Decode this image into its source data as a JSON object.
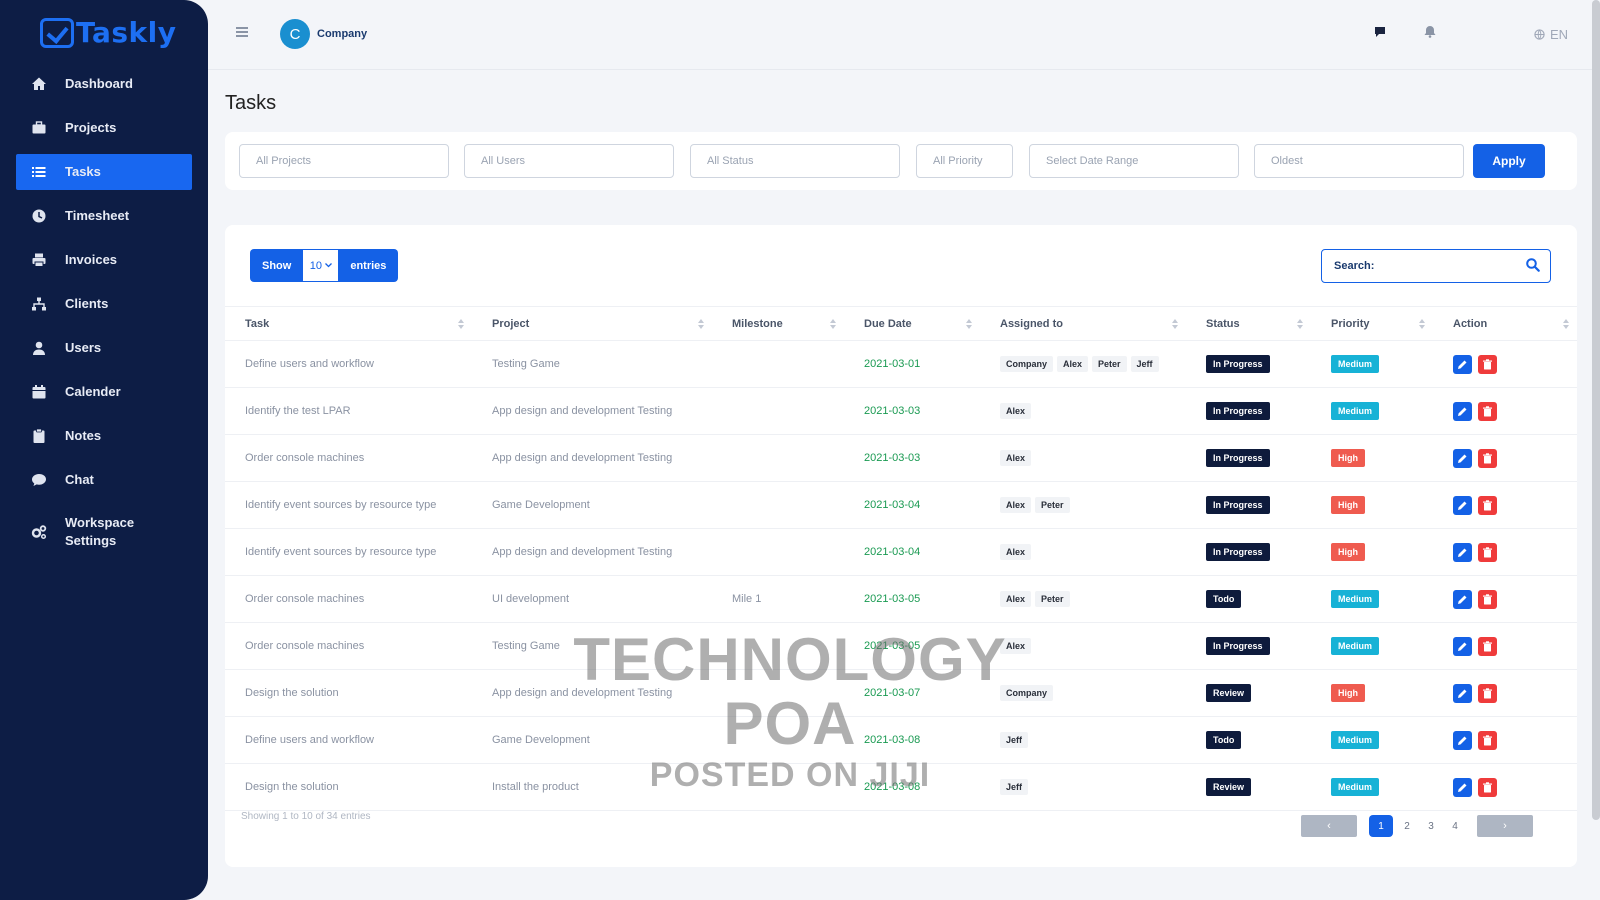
{
  "app": {
    "name": "Taskly"
  },
  "sidebar": {
    "items": [
      {
        "label": "Dashboard",
        "icon": "home-icon"
      },
      {
        "label": "Projects",
        "icon": "briefcase-icon"
      },
      {
        "label": "Tasks",
        "icon": "list-icon",
        "active": true
      },
      {
        "label": "Timesheet",
        "icon": "clock-icon"
      },
      {
        "label": "Invoices",
        "icon": "printer-icon"
      },
      {
        "label": "Clients",
        "icon": "sitemap-icon"
      },
      {
        "label": "Users",
        "icon": "user-icon"
      },
      {
        "label": "Calender",
        "icon": "calendar-icon"
      },
      {
        "label": "Notes",
        "icon": "clipboard-icon"
      },
      {
        "label": "Chat",
        "icon": "chat-icon"
      },
      {
        "label": "Workspace Settings",
        "icon": "cogs-icon"
      }
    ]
  },
  "header": {
    "company_initial": "C",
    "company_name": "Company",
    "language": "EN"
  },
  "page": {
    "title": "Tasks"
  },
  "filters": {
    "projects": "All Projects",
    "users": "All Users",
    "status": "All Status",
    "priority": "All Priority",
    "date_range": "Select Date Range",
    "sort": "Oldest",
    "apply_label": "Apply"
  },
  "table_controls": {
    "show_label": "Show",
    "entries_value": "10",
    "entries_label": "entries",
    "search_label": "Search:"
  },
  "table": {
    "columns": [
      "Task",
      "Project",
      "Milestone",
      "Due Date",
      "Assigned to",
      "Status",
      "Priority",
      "Action"
    ],
    "rows": [
      {
        "task": "Define users and workflow",
        "project": "Testing Game",
        "milestone": "",
        "due": "2021-03-01",
        "assigned": [
          "Company",
          "Alex",
          "Peter",
          "Jeff"
        ],
        "status": "In Progress",
        "priority": "Medium"
      },
      {
        "task": "Identify the test LPAR",
        "project": "App design and development Testing",
        "milestone": "",
        "due": "2021-03-03",
        "assigned": [
          "Alex"
        ],
        "status": "In Progress",
        "priority": "Medium"
      },
      {
        "task": "Order console machines",
        "project": "App design and development Testing",
        "milestone": "",
        "due": "2021-03-03",
        "assigned": [
          "Alex"
        ],
        "status": "In Progress",
        "priority": "High"
      },
      {
        "task": "Identify event sources by resource type",
        "project": "Game Development",
        "milestone": "",
        "due": "2021-03-04",
        "assigned": [
          "Alex",
          "Peter"
        ],
        "status": "In Progress",
        "priority": "High"
      },
      {
        "task": "Identify event sources by resource type",
        "project": "App design and development Testing",
        "milestone": "",
        "due": "2021-03-04",
        "assigned": [
          "Alex"
        ],
        "status": "In Progress",
        "priority": "High"
      },
      {
        "task": "Order console machines",
        "project": "UI development",
        "milestone": "Mile 1",
        "due": "2021-03-05",
        "assigned": [
          "Alex",
          "Peter"
        ],
        "status": "Todo",
        "priority": "Medium"
      },
      {
        "task": "Order console machines",
        "project": "Testing Game",
        "milestone": "",
        "due": "2021-03-05",
        "assigned": [
          "Alex"
        ],
        "status": "In Progress",
        "priority": "Medium"
      },
      {
        "task": "Design the solution",
        "project": "App design and development Testing",
        "milestone": "",
        "due": "2021-03-07",
        "assigned": [
          "Company"
        ],
        "status": "Review",
        "priority": "High"
      },
      {
        "task": "Define users and workflow",
        "project": "Game Development",
        "milestone": "",
        "due": "2021-03-08",
        "assigned": [
          "Jeff"
        ],
        "status": "Todo",
        "priority": "Medium"
      },
      {
        "task": "Design the solution",
        "project": "Install the product",
        "milestone": "",
        "due": "2021-03-08",
        "assigned": [
          "Jeff"
        ],
        "status": "Review",
        "priority": "Medium"
      }
    ]
  },
  "footer": {
    "showing": "Showing 1 to 10 of 34 entries",
    "prev": "‹",
    "next": "›",
    "pages": [
      "1",
      "2",
      "3",
      "4"
    ],
    "current_page": "1"
  },
  "watermark": {
    "line1": "TECHNOLOGY POA",
    "line2": "POSTED ON JIJI"
  },
  "colors": {
    "sidebar": "#0d1d45",
    "accent": "#1461e6",
    "medium": "#17b2d6",
    "high": "#ef5b4f",
    "date": "#1a9a52"
  }
}
